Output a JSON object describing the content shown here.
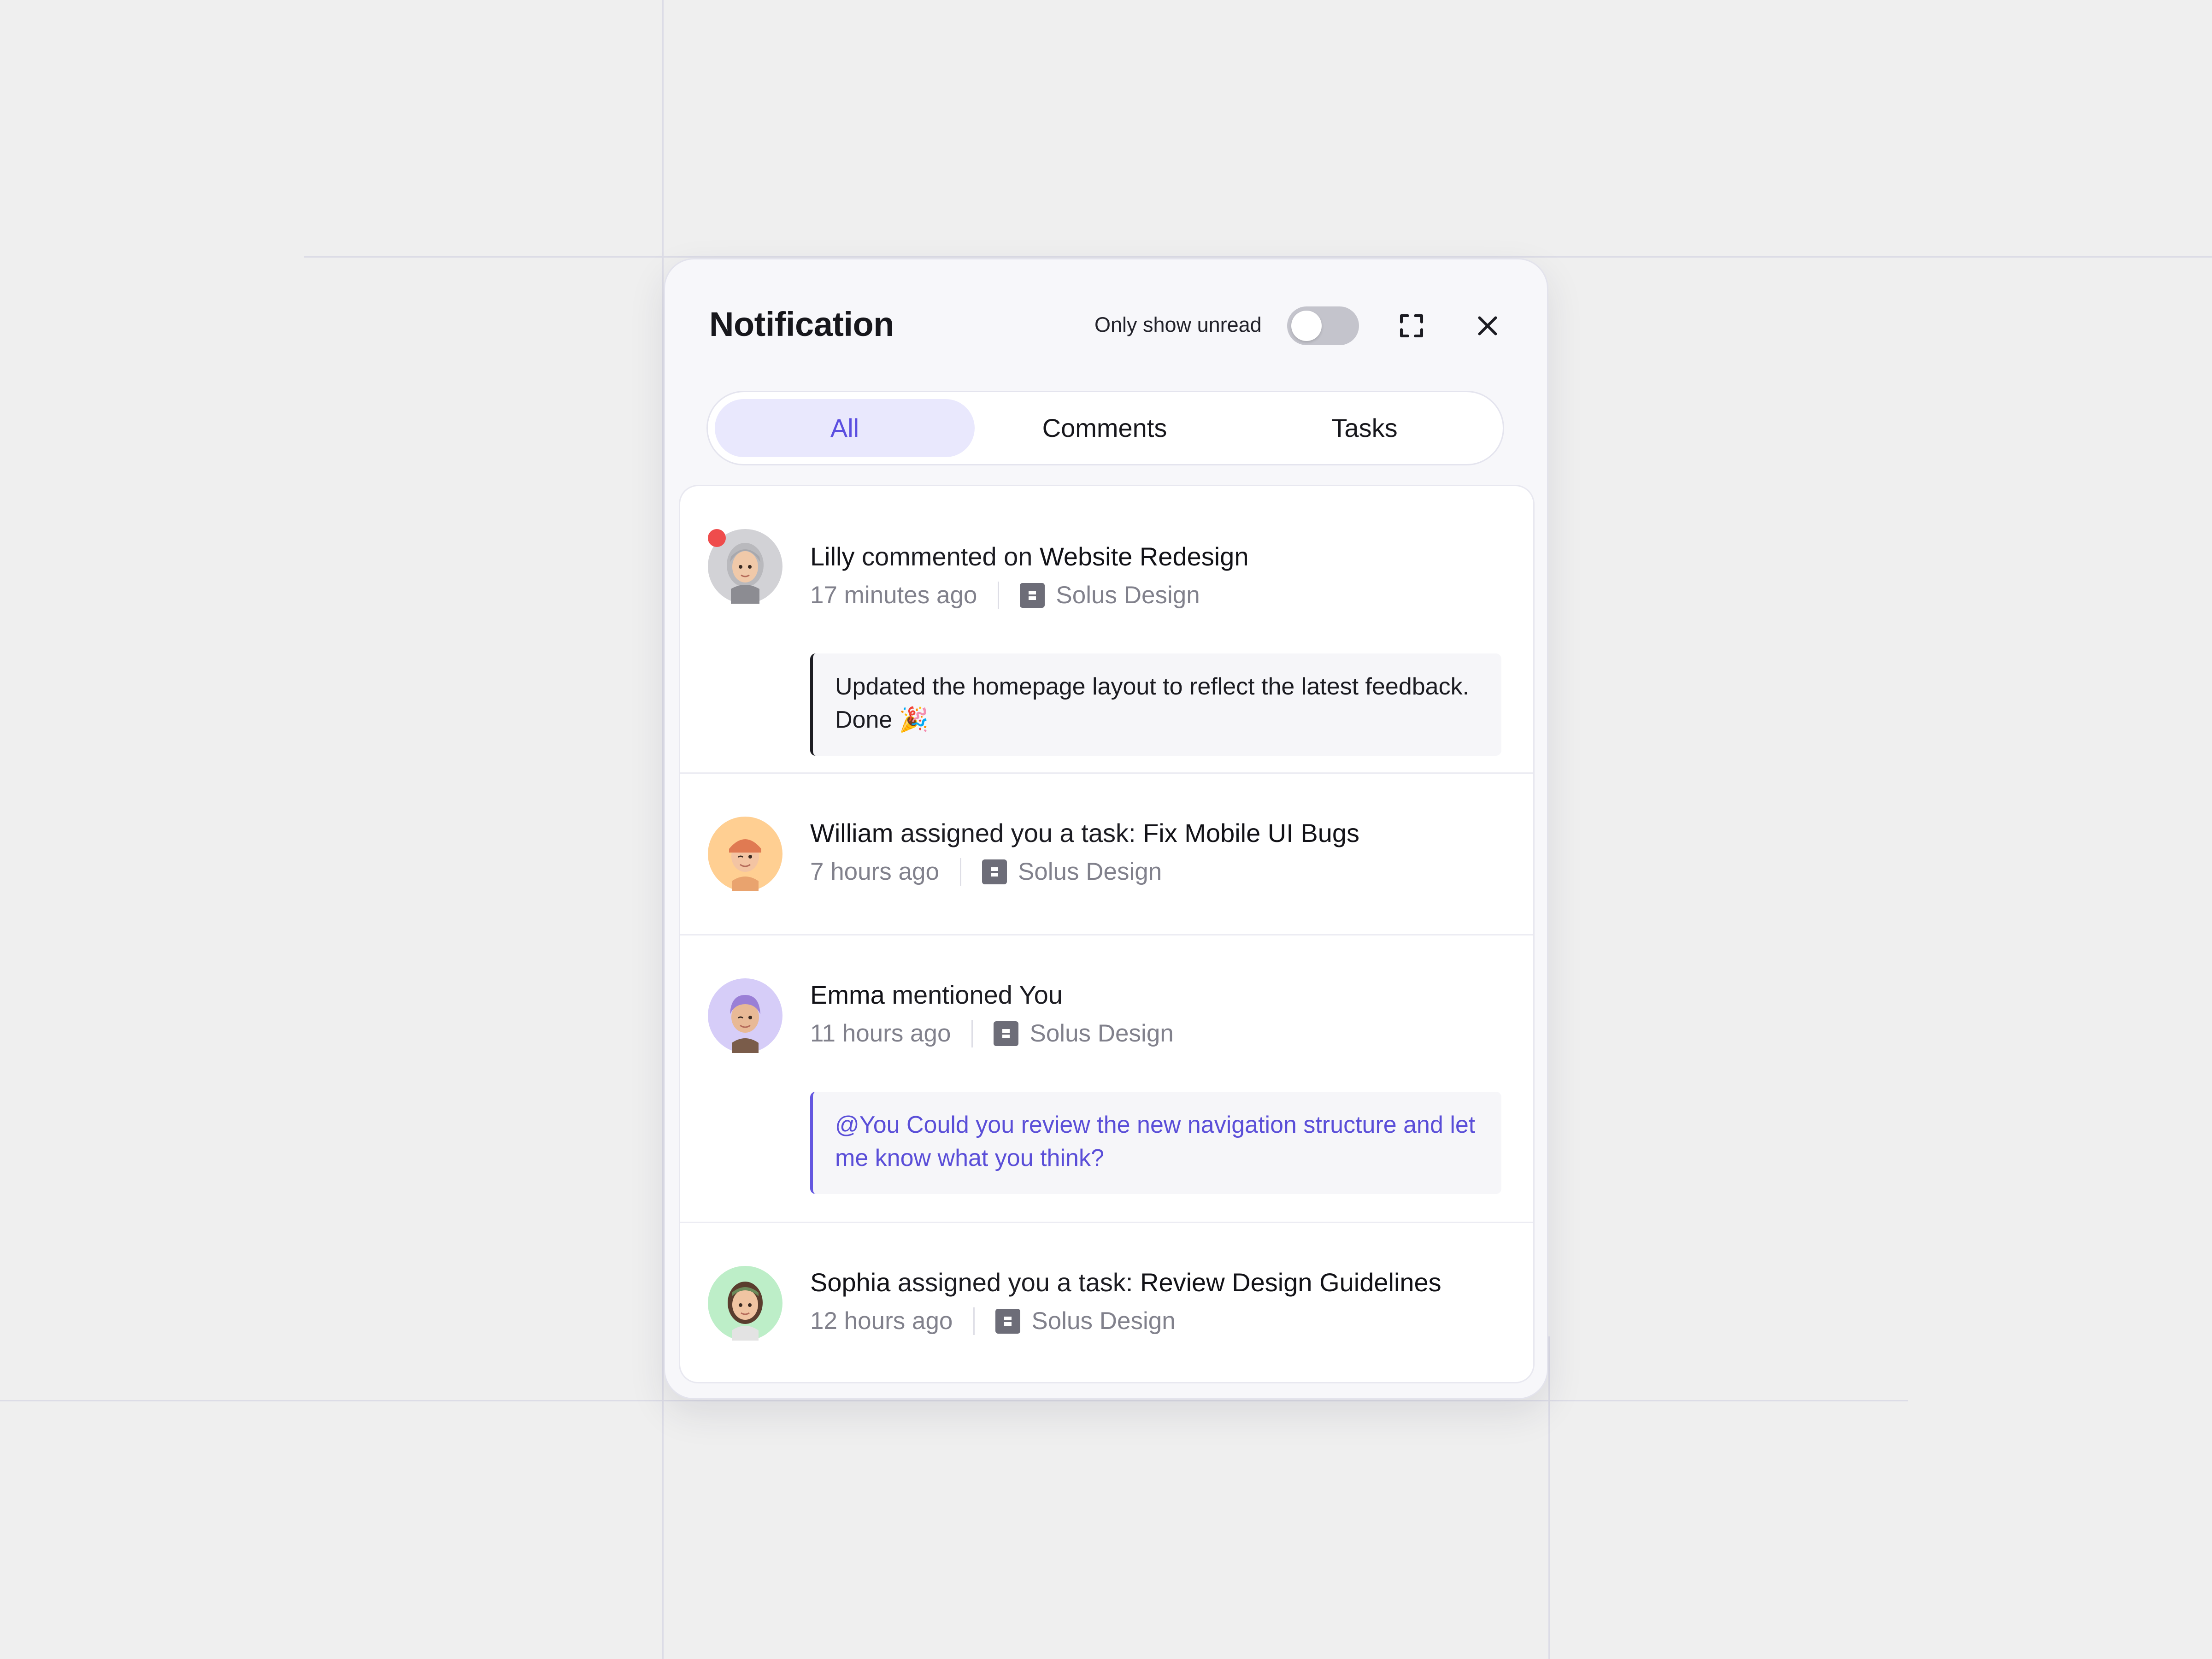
{
  "panel": {
    "title": "Notification",
    "only_unread_label": "Only show unread",
    "only_unread_on": false
  },
  "tabs": [
    {
      "label": "All",
      "active": true
    },
    {
      "label": "Comments",
      "active": false
    },
    {
      "label": "Tasks",
      "active": false
    }
  ],
  "notifications": [
    {
      "actor": "Lilly",
      "action": " commented on ",
      "target": "Website Redesign",
      "time": "17 minutes ago",
      "workspace": "Solus Design",
      "unread": true,
      "quote": "Updated the homepage layout to reflect the latest feedback. Done 🎉"
    },
    {
      "actor": "William",
      "action": " assigned you a task: ",
      "target": "Fix Mobile UI Bugs",
      "time": "7 hours ago",
      "workspace": "Solus Design",
      "unread": false
    },
    {
      "actor": "Emma",
      "action": " mentioned ",
      "target": "You",
      "time": "11 hours ago",
      "workspace": "Solus Design",
      "unread": false,
      "quote": "@You Could you review the new navigation structure and let me know what you think?"
    },
    {
      "actor": "Sophia",
      "action": " assigned you a task: ",
      "target": "Review Design Guidelines",
      "time": "12 hours ago",
      "workspace": "Solus Design",
      "unread": false
    }
  ],
  "colors": {
    "accent": "#5b4ee0",
    "active_tab_bg": "#e9e8fd",
    "unread_dot": "#ef4c4c",
    "avatar_bg": [
      "#d2d2d6",
      "#ffcf92",
      "#d6cdf8",
      "#bdeec8"
    ]
  },
  "icons": [
    "fullscreen-icon",
    "close-icon",
    "workspace-logo-icon"
  ]
}
